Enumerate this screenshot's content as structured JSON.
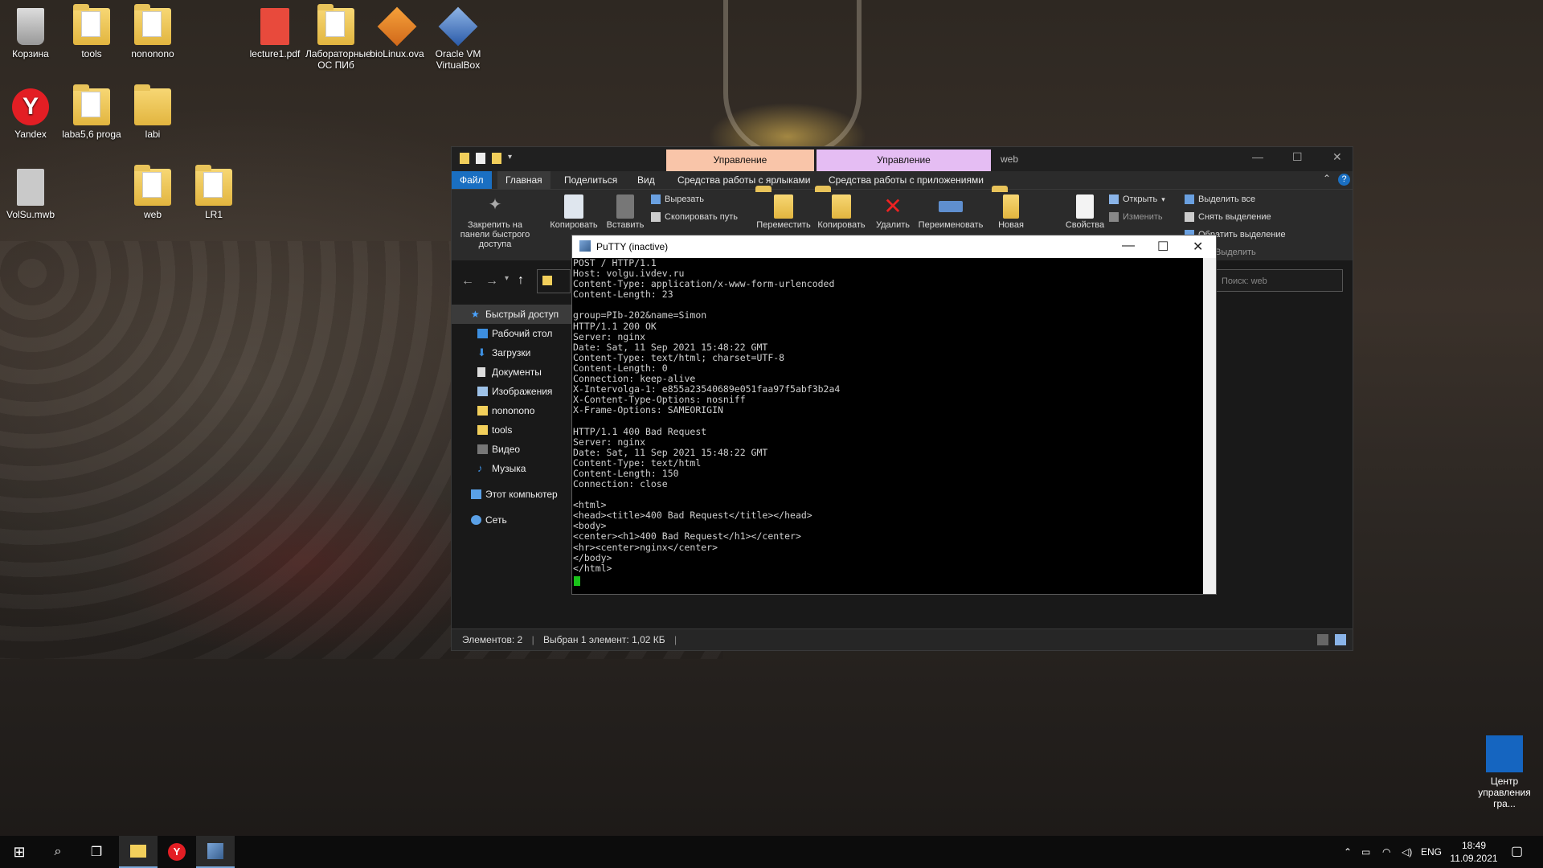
{
  "desktop": {
    "icons": [
      {
        "label": "Корзина"
      },
      {
        "label": "tools"
      },
      {
        "label": "nononono"
      },
      {
        "label": "lecture1.pdf"
      },
      {
        "label": "Лабораторные ОС ПИб"
      },
      {
        "label": "bioLinux.ova"
      },
      {
        "label": "Oracle VM VirtualBox"
      },
      {
        "label": "Yandex"
      },
      {
        "label": "laba5,6 proga"
      },
      {
        "label": "labi"
      },
      {
        "label": "VolSu.mwb"
      },
      {
        "label": "web"
      },
      {
        "label": "LR1"
      }
    ],
    "control_center": {
      "label": "Центр управления гра..."
    }
  },
  "explorer": {
    "title": "web",
    "context_tabs": [
      "Управление",
      "Управление"
    ],
    "ribbon_tabs": [
      "Файл",
      "Главная",
      "Поделиться",
      "Вид",
      "Средства работы с ярлыками",
      "Средства работы с приложениями"
    ],
    "ribbon": {
      "pin": "Закрепить на панели быстрого доступа",
      "copy": "Копировать",
      "paste": "Вставить",
      "cut": "Вырезать",
      "copy_path": "Скопировать путь",
      "move": "Переместить",
      "copy_to": "Копировать",
      "delete": "Удалить",
      "rename": "Переименовать",
      "new": "Новая",
      "properties": "Свойства",
      "open": "Открыть",
      "edit": "Изменить",
      "select_all": "Выделить все",
      "select_none": "Снять выделение",
      "invert": "Обратить выделение",
      "select_group": "Выделить"
    },
    "search_placeholder": "Поиск: web",
    "nav": [
      {
        "label": "Быстрый доступ"
      },
      {
        "label": "Рабочий стол"
      },
      {
        "label": "Загрузки"
      },
      {
        "label": "Документы"
      },
      {
        "label": "Изображения"
      },
      {
        "label": "nononono"
      },
      {
        "label": "tools"
      },
      {
        "label": "Видео"
      },
      {
        "label": "Музыка"
      },
      {
        "label": "Этот компьютер"
      },
      {
        "label": "Сеть"
      }
    ],
    "status": {
      "items": "Элементов: 2",
      "selected": "Выбран 1 элемент: 1,02 КБ"
    }
  },
  "putty": {
    "title": "PuTTY (inactive)",
    "terminal": "POST / HTTP/1.1\nHost: volgu.ivdev.ru\nContent-Type: application/x-www-form-urlencoded\nContent-Length: 23\n\ngroup=PIb-202&name=Simon\nHTTP/1.1 200 OK\nServer: nginx\nDate: Sat, 11 Sep 2021 15:48:22 GMT\nContent-Type: text/html; charset=UTF-8\nContent-Length: 0\nConnection: keep-alive\nX-Intervolga-1: e855a23540689e051faa97f5abf3b2a4\nX-Content-Type-Options: nosniff\nX-Frame-Options: SAMEORIGIN\n\nHTTP/1.1 400 Bad Request\nServer: nginx\nDate: Sat, 11 Sep 2021 15:48:22 GMT\nContent-Type: text/html\nContent-Length: 150\nConnection: close\n\n<html>\n<head><title>400 Bad Request</title></head>\n<body>\n<center><h1>400 Bad Request</h1></center>\n<hr><center>nginx</center>\n</body>\n</html>"
  },
  "taskbar": {
    "lang": "ENG",
    "time": "18:49",
    "date": "11.09.2021"
  }
}
